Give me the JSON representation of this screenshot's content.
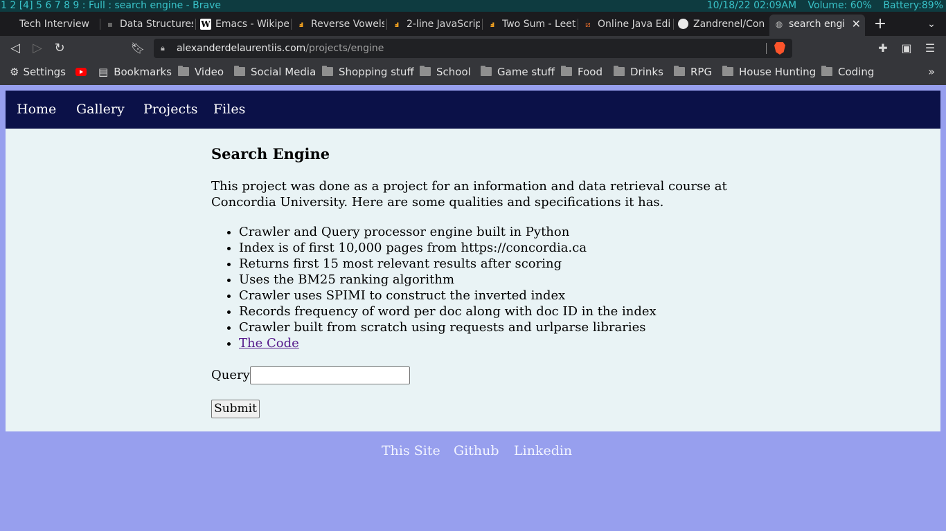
{
  "wm": {
    "workspaces": "1 2 [4] 5 6 7 8 9 : Full : search engine - Brave",
    "datetime": "10/18/22  02:09AM",
    "volume": "Volume: 60%",
    "battery": "Battery:89%"
  },
  "tabs": [
    {
      "label": "Tech Interview",
      "icon": "tech-icon"
    },
    {
      "label": "Data Structures",
      "icon": "ds-icon"
    },
    {
      "label": "Emacs - Wikipe",
      "icon": "wikipedia-icon"
    },
    {
      "label": "Reverse Vowels",
      "icon": "leetcode-icon"
    },
    {
      "label": "2-line JavaScrip",
      "icon": "leetcode-icon"
    },
    {
      "label": "Two Sum - Leet",
      "icon": "leetcode-icon"
    },
    {
      "label": "Online Java Edi",
      "icon": "java-icon"
    },
    {
      "label": "Zandrenel/Con",
      "icon": "github-icon"
    },
    {
      "label": "search engi",
      "icon": "globe-icon",
      "active": true
    }
  ],
  "toolbar": {
    "url_domain": "alexanderdelaurentiis.com",
    "url_path": "/projects/engine"
  },
  "bookmarks": [
    {
      "label": "Settings",
      "type": "settings"
    },
    {
      "label": "",
      "type": "youtube"
    },
    {
      "label": "Bookmarks",
      "type": "bookmarks"
    },
    {
      "label": "Video",
      "type": "folder"
    },
    {
      "label": "Social Media",
      "type": "folder"
    },
    {
      "label": "Shopping stuff",
      "type": "folder"
    },
    {
      "label": "School",
      "type": "folder"
    },
    {
      "label": "Game stuff",
      "type": "folder"
    },
    {
      "label": "Food",
      "type": "folder"
    },
    {
      "label": "Drinks",
      "type": "folder"
    },
    {
      "label": "RPG",
      "type": "folder"
    },
    {
      "label": "House Hunting",
      "type": "folder"
    },
    {
      "label": "Coding",
      "type": "folder"
    }
  ],
  "site": {
    "nav": [
      "Home",
      "Gallery",
      "Projects",
      "Files"
    ],
    "title": "Search Engine",
    "intro": "This project was done as a project for an information and data retrieval course at Concordia University. Here are some qualities and specifications it has.",
    "features": [
      "Crawler and Query processor engine built in Python",
      "Index is of first 10,000 pages from https://concordia.ca",
      "Returns first 15 most relevant results after scoring",
      "Uses the BM25 ranking algorithm",
      "Crawler uses SPIMI to construct the inverted index",
      "Records frequency of word per doc along with doc ID in the index",
      "Crawler built from scratch using requests and urlparse libraries"
    ],
    "code_link": "The Code",
    "query_label": "Query:",
    "query_value": "",
    "submit_label": "Submit",
    "footer": [
      "This Site",
      "Github",
      "Linkedin"
    ]
  }
}
